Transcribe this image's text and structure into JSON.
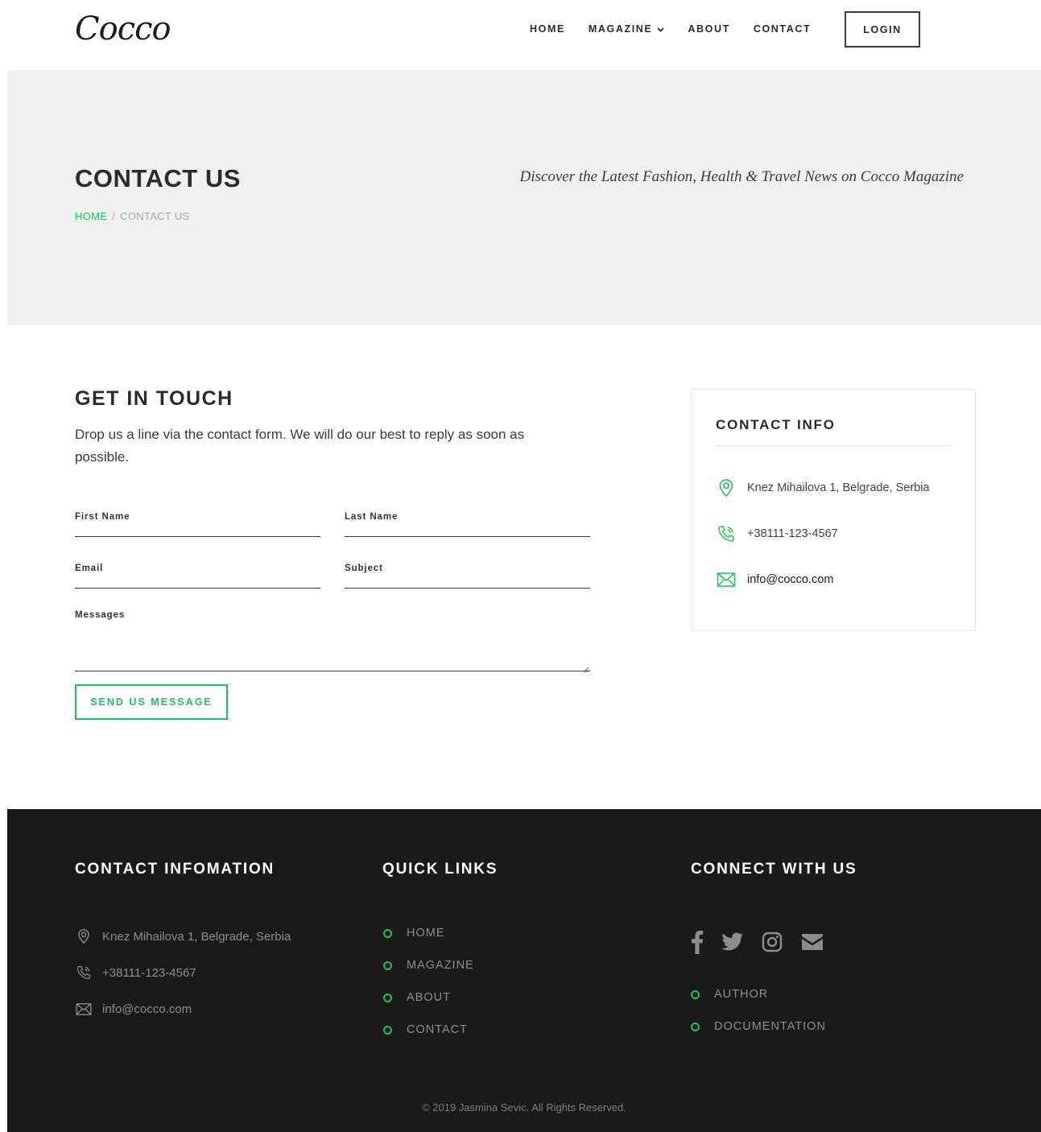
{
  "header": {
    "logo_text": "Cocco",
    "nav": [
      {
        "label": "HOME"
      },
      {
        "label": "MAGAZINE"
      },
      {
        "label": "ABOUT"
      },
      {
        "label": "CONTACT"
      }
    ],
    "login_label": "LOGIN"
  },
  "hero": {
    "title": "CONTACT US",
    "breadcrumb_home": "HOME",
    "breadcrumb_sep": "/",
    "breadcrumb_current": "CONTACT US",
    "tagline": "Discover the Latest Fashion, Health & Travel News on Cocco Magazine"
  },
  "form": {
    "title": "GET IN TOUCH",
    "description": "Drop us a line via the contact form. We will do our best to reply as soon as possible.",
    "first_name": "First Name",
    "last_name": "Last Name",
    "email": "Email",
    "subject": "Subject",
    "messages": "Messages",
    "send_label": "SEND US MESSAGE"
  },
  "contact_info": {
    "title": "CONTACT INFO",
    "address": "Knez Mihailova 1, Belgrade, Serbia",
    "phone": "+38111-123-4567",
    "email": "info@cocco.com"
  },
  "footer": {
    "contact_heading": "CONTACT INFOMATION",
    "address": "Knez Mihailova 1, Belgrade, Serbia",
    "phone": "+38111-123-4567",
    "email": "info@cocco.com",
    "quick_heading": "QUICK LINKS",
    "quick_links": [
      {
        "label": "HOME"
      },
      {
        "label": "MAGAZINE"
      },
      {
        "label": "ABOUT"
      },
      {
        "label": "CONTACT"
      }
    ],
    "connect_heading": "CONNECT WITH US",
    "connect_links": [
      {
        "label": "AUTHOR"
      },
      {
        "label": "DOCUMENTATION"
      }
    ],
    "copyright": "© 2019 Jasmina Sevic. All Rights Reserved."
  },
  "colors": {
    "accent": "#1ec35a",
    "hero_bg": "#f0f0f0",
    "footer_bg": "#1a1a1a"
  }
}
